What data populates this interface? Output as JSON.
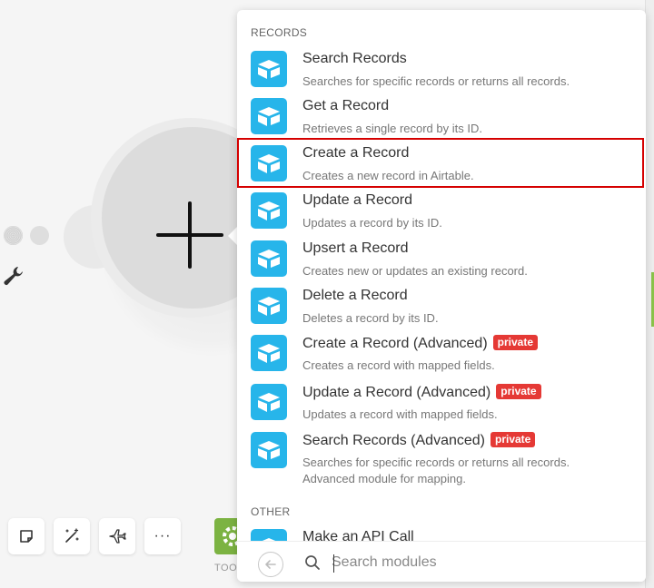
{
  "sections": {
    "records_title": "RECORDS",
    "other_title": "OTHER"
  },
  "modules": [
    {
      "name": "Search Records",
      "desc": "Searches for specific records or returns all records.",
      "badge": ""
    },
    {
      "name": "Get a Record",
      "desc": "Retrieves a single record by its ID.",
      "badge": ""
    },
    {
      "name": "Create a Record",
      "desc": "Creates a new record in Airtable.",
      "badge": ""
    },
    {
      "name": "Update a Record",
      "desc": "Updates a record by its ID.",
      "badge": ""
    },
    {
      "name": "Upsert a Record",
      "desc": "Creates new or updates an existing record.",
      "badge": ""
    },
    {
      "name": "Delete a Record",
      "desc": "Deletes a record by its ID.",
      "badge": ""
    },
    {
      "name": "Create a Record (Advanced)",
      "desc": "Creates a record with mapped fields.",
      "badge": "private"
    },
    {
      "name": "Update a Record (Advanced)",
      "desc": "Updates a record with mapped fields.",
      "badge": "private"
    },
    {
      "name": "Search Records (Advanced)",
      "desc": "Searches for specific records or returns all records.",
      "desc2": "Advanced module for mapping.",
      "badge": "private"
    }
  ],
  "other_modules": [
    {
      "name": "Make an API Call"
    }
  ],
  "search": {
    "placeholder": "Search modules",
    "value": ""
  },
  "toolbar": {
    "tools_label": "TOO"
  },
  "icons": {
    "module_logo": "airtable-box-icon",
    "back": "arrow-left-icon",
    "search": "search-icon",
    "canvas_add": "plus-icon",
    "wrench": "wrench-icon",
    "note": "note-icon",
    "magic": "magic-wand-icon",
    "plane": "airplane-icon",
    "more": "more-horizontal-icon",
    "gear": "gear-icon"
  },
  "colors": {
    "module_accent": "#27b5ea",
    "badge_bg": "#e53935",
    "highlight": "#d50000",
    "tools_green": "#7cb342"
  }
}
